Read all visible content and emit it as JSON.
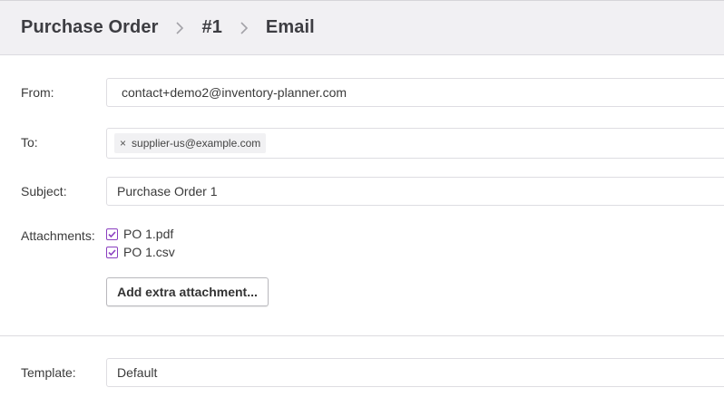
{
  "breadcrumb": {
    "items": [
      "Purchase Order",
      "#1",
      "Email"
    ]
  },
  "form": {
    "from_label": "From:",
    "from_value": "contact+demo2@inventory-planner.com",
    "to_label": "To:",
    "to_tags": [
      "supplier-us@example.com"
    ],
    "tag_remove_glyph": "×",
    "subject_label": "Subject:",
    "subject_value": "Purchase Order 1",
    "attachments_label": "Attachments:",
    "attachments": [
      {
        "name": "PO 1.pdf",
        "checked": true
      },
      {
        "name": "PO 1.csv",
        "checked": true
      }
    ],
    "add_attachment_label": "Add extra attachment...",
    "template_label": "Template:",
    "template_value": "Default"
  },
  "colors": {
    "header_bg": "#f1f0f3",
    "accent_checkbox": "#8b3fc0"
  },
  "icons": {
    "breadcrumb_separator": "chevron-right-icon",
    "checkbox": "check-icon"
  }
}
